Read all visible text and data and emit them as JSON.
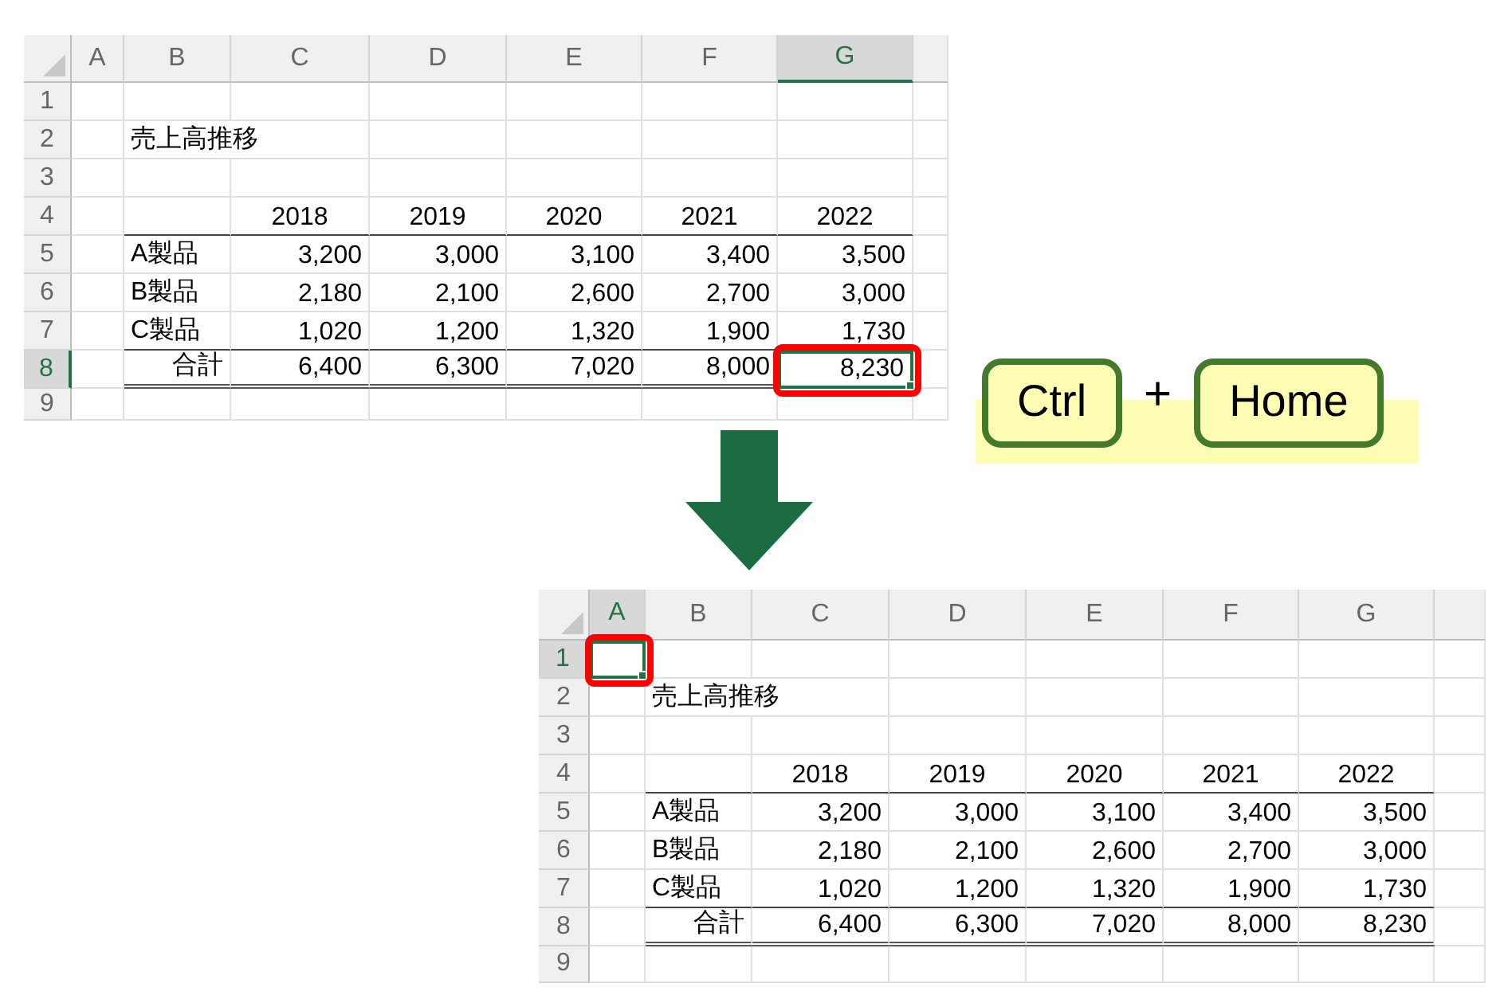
{
  "sheets": [
    {
      "columns": [
        {
          "label": "A",
          "selected": false
        },
        {
          "label": "B",
          "selected": false
        },
        {
          "label": "C",
          "selected": false
        },
        {
          "label": "D",
          "selected": false
        },
        {
          "label": "E",
          "selected": false
        },
        {
          "label": "F",
          "selected": false
        },
        {
          "label": "G",
          "selected": true
        }
      ],
      "rows": [
        {
          "number": "1",
          "selected": false,
          "kind": "blank"
        },
        {
          "number": "2",
          "selected": false,
          "kind": "title",
          "title": "売上高推移"
        },
        {
          "number": "3",
          "selected": false,
          "kind": "blank"
        },
        {
          "number": "4",
          "selected": false,
          "kind": "years",
          "values": [
            "2018",
            "2019",
            "2020",
            "2021",
            "2022"
          ]
        },
        {
          "number": "5",
          "selected": false,
          "kind": "data",
          "label": "A製品",
          "values": [
            "3,200",
            "3,000",
            "3,100",
            "3,400",
            "3,500"
          ]
        },
        {
          "number": "6",
          "selected": false,
          "kind": "data",
          "label": "B製品",
          "values": [
            "2,180",
            "2,100",
            "2,600",
            "2,700",
            "3,000"
          ]
        },
        {
          "number": "7",
          "selected": false,
          "kind": "data",
          "label": "C製品",
          "values": [
            "1,020",
            "1,200",
            "1,320",
            "1,900",
            "1,730"
          ]
        },
        {
          "number": "8",
          "selected": true,
          "kind": "total",
          "label": "合計",
          "values": [
            "6,400",
            "6,300",
            "7,020",
            "8,000",
            "8,230"
          ]
        },
        {
          "number": "9",
          "selected": false,
          "kind": "blank"
        }
      ]
    },
    {
      "columns": [
        {
          "label": "A",
          "selected": true
        },
        {
          "label": "B",
          "selected": false
        },
        {
          "label": "C",
          "selected": false
        },
        {
          "label": "D",
          "selected": false
        },
        {
          "label": "E",
          "selected": false
        },
        {
          "label": "F",
          "selected": false
        },
        {
          "label": "G",
          "selected": false
        }
      ],
      "rows": [
        {
          "number": "1",
          "selected": true,
          "kind": "blank"
        },
        {
          "number": "2",
          "selected": false,
          "kind": "title",
          "title": "売上高推移"
        },
        {
          "number": "3",
          "selected": false,
          "kind": "blank"
        },
        {
          "number": "4",
          "selected": false,
          "kind": "years",
          "values": [
            "2018",
            "2019",
            "2020",
            "2021",
            "2022"
          ]
        },
        {
          "number": "5",
          "selected": false,
          "kind": "data",
          "label": "A製品",
          "values": [
            "3,200",
            "3,000",
            "3,100",
            "3,400",
            "3,500"
          ]
        },
        {
          "number": "6",
          "selected": false,
          "kind": "data",
          "label": "B製品",
          "values": [
            "2,180",
            "2,100",
            "2,600",
            "2,700",
            "3,000"
          ]
        },
        {
          "number": "7",
          "selected": false,
          "kind": "data",
          "label": "C製品",
          "values": [
            "1,020",
            "1,200",
            "1,320",
            "1,900",
            "1,730"
          ]
        },
        {
          "number": "8",
          "selected": false,
          "kind": "total",
          "label": "合計",
          "values": [
            "6,400",
            "6,300",
            "7,020",
            "8,000",
            "8,230"
          ]
        },
        {
          "number": "9",
          "selected": false,
          "kind": "blank"
        }
      ]
    }
  ],
  "shortcut": {
    "keys": [
      "Ctrl",
      "Home"
    ],
    "separator": "+"
  }
}
